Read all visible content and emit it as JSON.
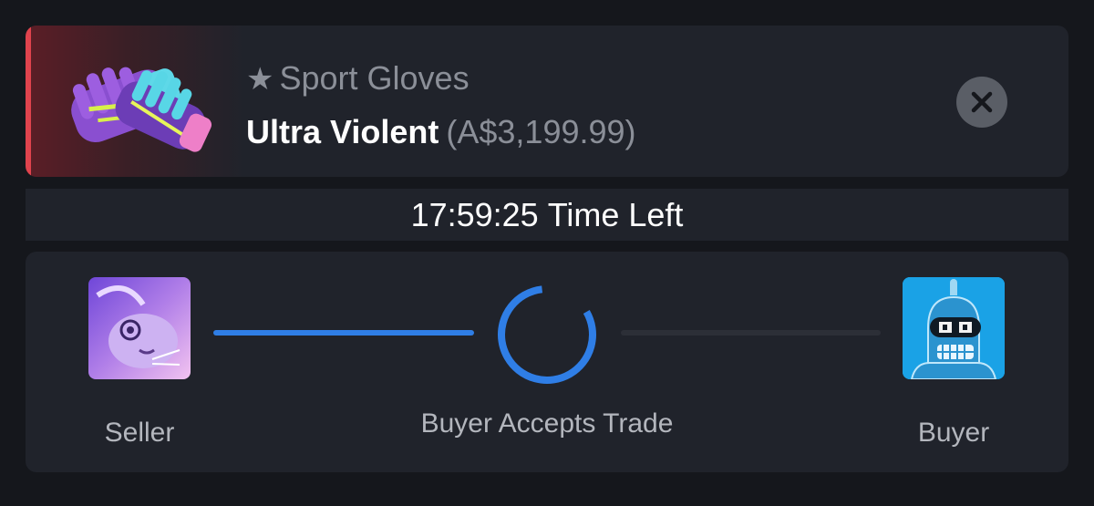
{
  "item": {
    "star": "★",
    "category": "Sport Gloves",
    "name": "Ultra Violent",
    "price": "(A$3,199.99)",
    "rarity_color": "#e0434d",
    "image_icon": "gloves-icon"
  },
  "close_icon": "close-icon",
  "timer": {
    "time": "17:59:25",
    "suffix": "Time Left"
  },
  "trade": {
    "seller_label": "Seller",
    "buyer_label": "Buyer",
    "step_label": "Buyer Accepts Trade",
    "accent_color": "#2f7ee6",
    "completed_steps": 1,
    "total_steps": 2
  }
}
